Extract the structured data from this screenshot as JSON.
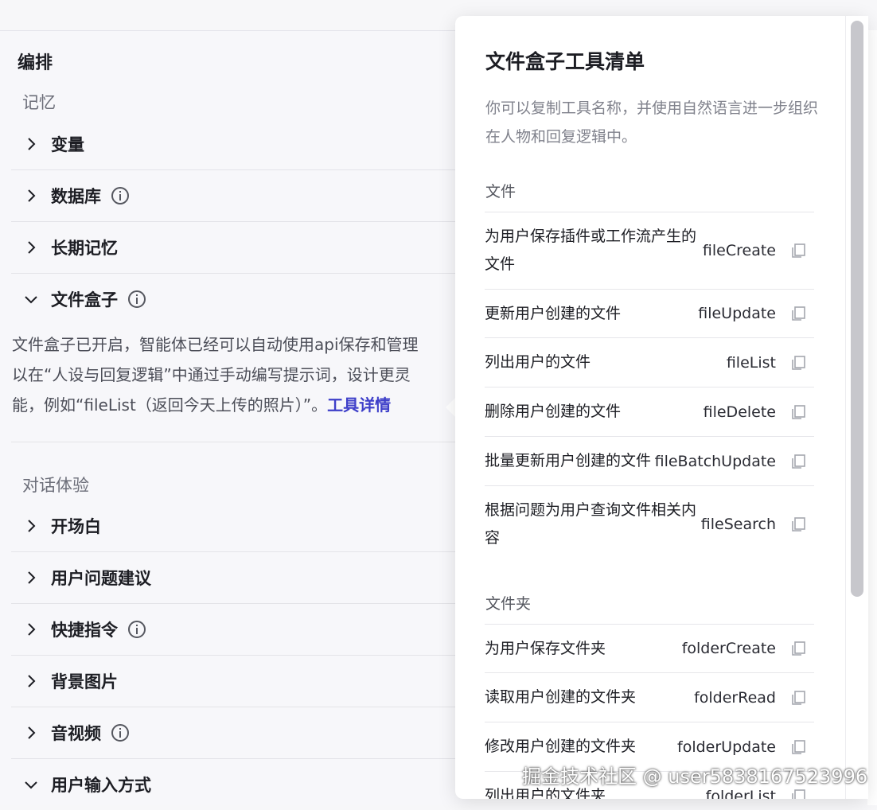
{
  "left": {
    "section_title": "编排",
    "memory": {
      "title": "记忆",
      "items": [
        {
          "label": "变量"
        },
        {
          "label": "数据库"
        },
        {
          "label": "长期记忆"
        },
        {
          "label": "文件盒子"
        }
      ],
      "file_box_desc_line1": "文件盒子已开启，智能体已经可以自动使用api保存和管理",
      "file_box_desc_line2": "以在“人设与回复逻辑”中通过手动编写提示词，设计更灵",
      "file_box_desc_line3": "能，例如“fileList（返回今天上传的照片）”。",
      "tool_detail_link": "工具详情"
    },
    "dialog": {
      "title": "对话体验",
      "items": [
        {
          "label": "开场白"
        },
        {
          "label": "用户问题建议"
        },
        {
          "label": "快捷指令"
        },
        {
          "label": "背景图片"
        },
        {
          "label": "音视频"
        },
        {
          "label": "用户输入方式"
        }
      ]
    }
  },
  "popup": {
    "title": "文件盒子工具清单",
    "desc": "你可以复制工具名称，并使用自然语言进一步组织在人物和回复逻辑中。",
    "file_category": "文件",
    "file_tools": [
      {
        "name": "为用户保存插件或工作流产生的文件",
        "id": "fileCreate"
      },
      {
        "name": "更新用户创建的文件",
        "id": "fileUpdate"
      },
      {
        "name": "列出用户的文件",
        "id": "fileList"
      },
      {
        "name": "删除用户创建的文件",
        "id": "fileDelete"
      },
      {
        "name": "批量更新用户创建的文件",
        "id": "fileBatchUpdate"
      },
      {
        "name": "根据问题为用户查询文件相关内容",
        "id": "fileSearch"
      }
    ],
    "folder_category": "文件夹",
    "folder_tools": [
      {
        "name": "为用户保存文件夹",
        "id": "folderCreate"
      },
      {
        "name": "读取用户创建的文件夹",
        "id": "folderRead"
      },
      {
        "name": "修改用户创建的文件夹",
        "id": "folderUpdate"
      },
      {
        "name": "列出用户的文件夹",
        "id": "folderList"
      }
    ]
  },
  "watermark": "掘金技术社区 @ user5838167523996",
  "colors": {
    "link": "#3e3fc9",
    "text": "#1c1d23",
    "muted": "#6b6d78"
  }
}
